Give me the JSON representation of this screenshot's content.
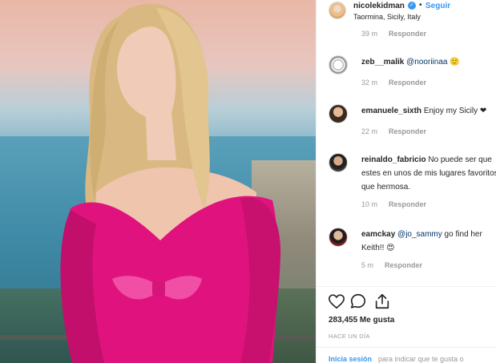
{
  "post": {
    "author": "nicolekidman",
    "follow_label": "Seguir",
    "dot": "•",
    "location": "Taormina, Sicily, Italy",
    "verified_icon": "verified-badge-icon"
  },
  "first_meta": {
    "time": "39 m",
    "reply": "Responder"
  },
  "comments": [
    {
      "user": "zeb__malik",
      "mention": "@nooriinaa",
      "text": " 🙂",
      "time": "32 m",
      "reply": "Responder"
    },
    {
      "user": "emanuele_sixth",
      "mention": "",
      "text": "Enjoy my Sicily ❤",
      "time": "22 m",
      "reply": "Responder"
    },
    {
      "user": "reinaldo_fabricio",
      "mention": "",
      "text": "No puede ser que estes en unos de mis lugares favoritos, que hermosa.",
      "time": "10 m",
      "reply": "Responder"
    },
    {
      "user": "eamckay",
      "mention": "@jo_sammy",
      "text": " go find her Keith!! 😍",
      "time": "5 m",
      "reply": "Responder"
    }
  ],
  "stats": {
    "likes": "283,455 Me gusta",
    "ago": "HACE UN DÍA"
  },
  "footer": {
    "login": "Inicia sesión",
    "rest": "para indicar que te gusta o"
  },
  "colors": {
    "accent": "#3897f0",
    "dress": "#e0137e",
    "text": "#262626",
    "muted": "#999999"
  }
}
